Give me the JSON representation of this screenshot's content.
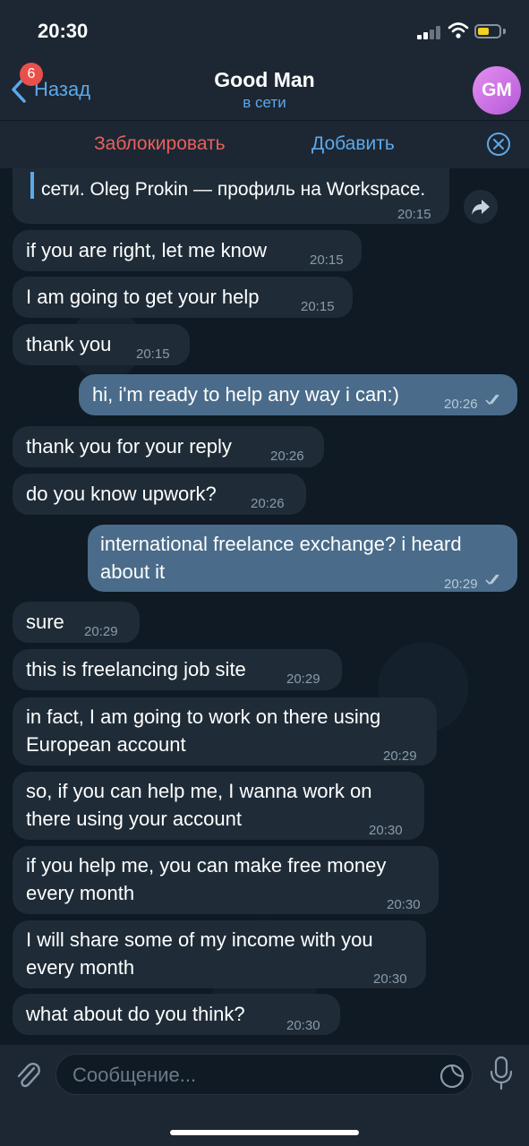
{
  "status": {
    "time": "20:30"
  },
  "header": {
    "back_label": "Назад",
    "unread_badge": "6",
    "title": "Good Man",
    "subtitle": "в сети",
    "avatar_initials": "GM"
  },
  "actions": {
    "block": "Заблокировать",
    "add": "Добавить"
  },
  "messages": [
    {
      "direction": "in",
      "text": "сети. Oleg Prokin — профиль на Workspace.",
      "time": "20:15",
      "partial": true
    },
    {
      "direction": "in",
      "text": "if you are right, let me know",
      "time": "20:15"
    },
    {
      "direction": "in",
      "text": "I am going to get your help",
      "time": "20:15"
    },
    {
      "direction": "in",
      "text": "thank you",
      "time": "20:15"
    },
    {
      "direction": "out",
      "text": "hi, i'm ready to help any way i can:)",
      "time": "20:26",
      "read": true
    },
    {
      "direction": "in",
      "text": "thank you for your reply",
      "time": "20:26"
    },
    {
      "direction": "in",
      "text": "do you know upwork?",
      "time": "20:26"
    },
    {
      "direction": "out",
      "text": "international freelance exchange? i heard about it",
      "time": "20:29",
      "read": true
    },
    {
      "direction": "in",
      "text": "sure",
      "time": "20:29"
    },
    {
      "direction": "in",
      "text": "this is freelancing job site",
      "time": "20:29"
    },
    {
      "direction": "in",
      "text": "in fact, I am going to work on there using European account",
      "time": "20:29"
    },
    {
      "direction": "in",
      "text": "so, if you can help me, I wanna work on there using your account",
      "time": "20:30"
    },
    {
      "direction": "in",
      "text": "if you help me, you can make free money every month",
      "time": "20:30"
    },
    {
      "direction": "in",
      "text": "I will share some of my income with you every month",
      "time": "20:30"
    },
    {
      "direction": "in",
      "text": "what about do you think?",
      "time": "20:30"
    }
  ],
  "composer": {
    "placeholder": "Сообщение..."
  },
  "colors": {
    "accent": "#5ea8e8",
    "danger": "#e8605c",
    "outgoing": "#4a6c8a",
    "incoming": "#1f2c38",
    "badge": "#e8504c"
  },
  "icons": [
    "back-chevron-icon",
    "close-circle-icon",
    "share-icon",
    "read-ticks-icon",
    "paperclip-icon",
    "sticker-icon",
    "microphone-icon"
  ]
}
